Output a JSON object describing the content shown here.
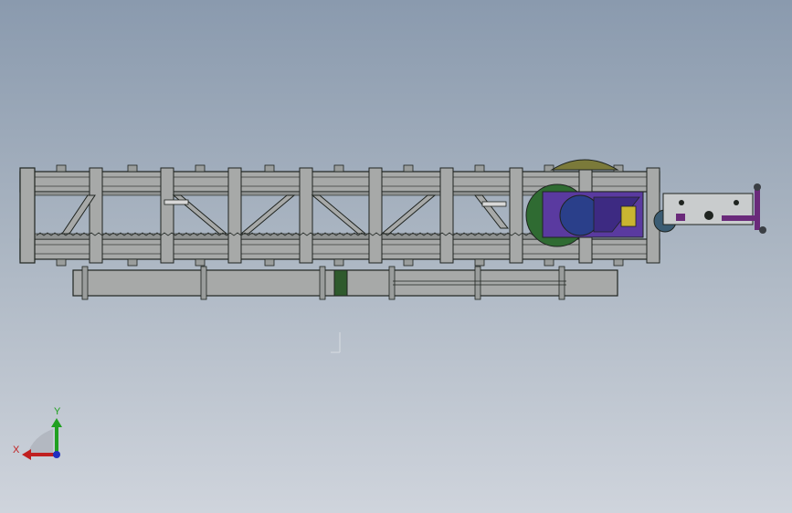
{
  "viewport": {
    "background_top": "#8a9aae",
    "background_bottom": "#cfd4dc",
    "model": {
      "frame_color": "#a7a9a8",
      "frame_outline": "#1f2420",
      "drum_color": "#2a3f8a",
      "motor_color": "#5a3aa0",
      "accent_green": "#2f6b32",
      "bracket_purple": "#6a2a7a"
    },
    "triad": {
      "x_label": "X",
      "y_label": "Y",
      "x_color": "#c02020",
      "y_color": "#20a020",
      "z_color": "#2030c0"
    }
  }
}
